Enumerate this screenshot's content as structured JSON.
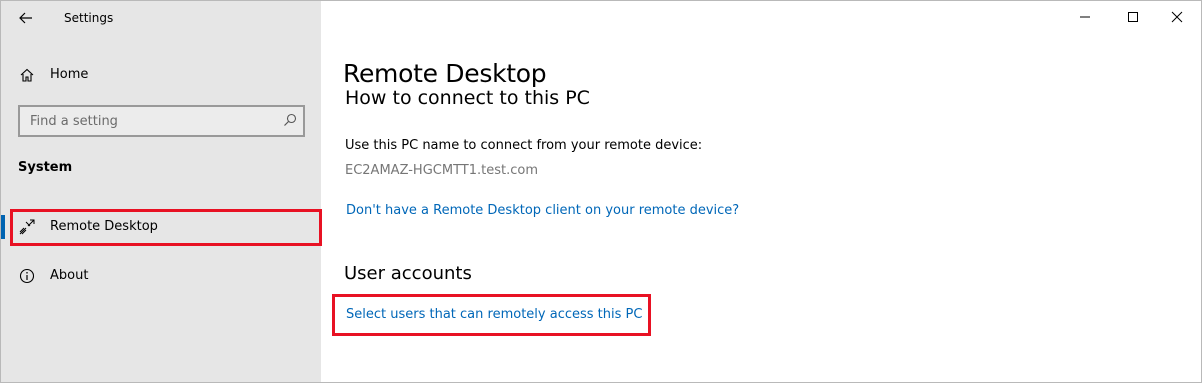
{
  "window": {
    "title": "Settings"
  },
  "sidebar": {
    "home_label": "Home",
    "search_placeholder": "Find a setting",
    "section_title": "System",
    "items": [
      {
        "label": "Remote Desktop",
        "icon": "remote-desktop-icon",
        "active": true
      },
      {
        "label": "About",
        "icon": "info-icon",
        "active": false
      }
    ]
  },
  "main": {
    "page_title": "Remote Desktop",
    "connect_heading": "How to connect to this PC",
    "connect_text": "Use this PC name to connect from your remote device:",
    "pc_name": "EC2AMAZ-HGCMTT1.test.com",
    "client_link": "Don't have a Remote Desktop client on your remote device?",
    "user_accounts_heading": "User accounts",
    "select_users_link": "Select users that can remotely access this PC"
  },
  "colors": {
    "accent": "#0063b1",
    "link": "#0067b8",
    "highlight": "#e81123",
    "sidebar_bg": "#e6e6e6"
  }
}
